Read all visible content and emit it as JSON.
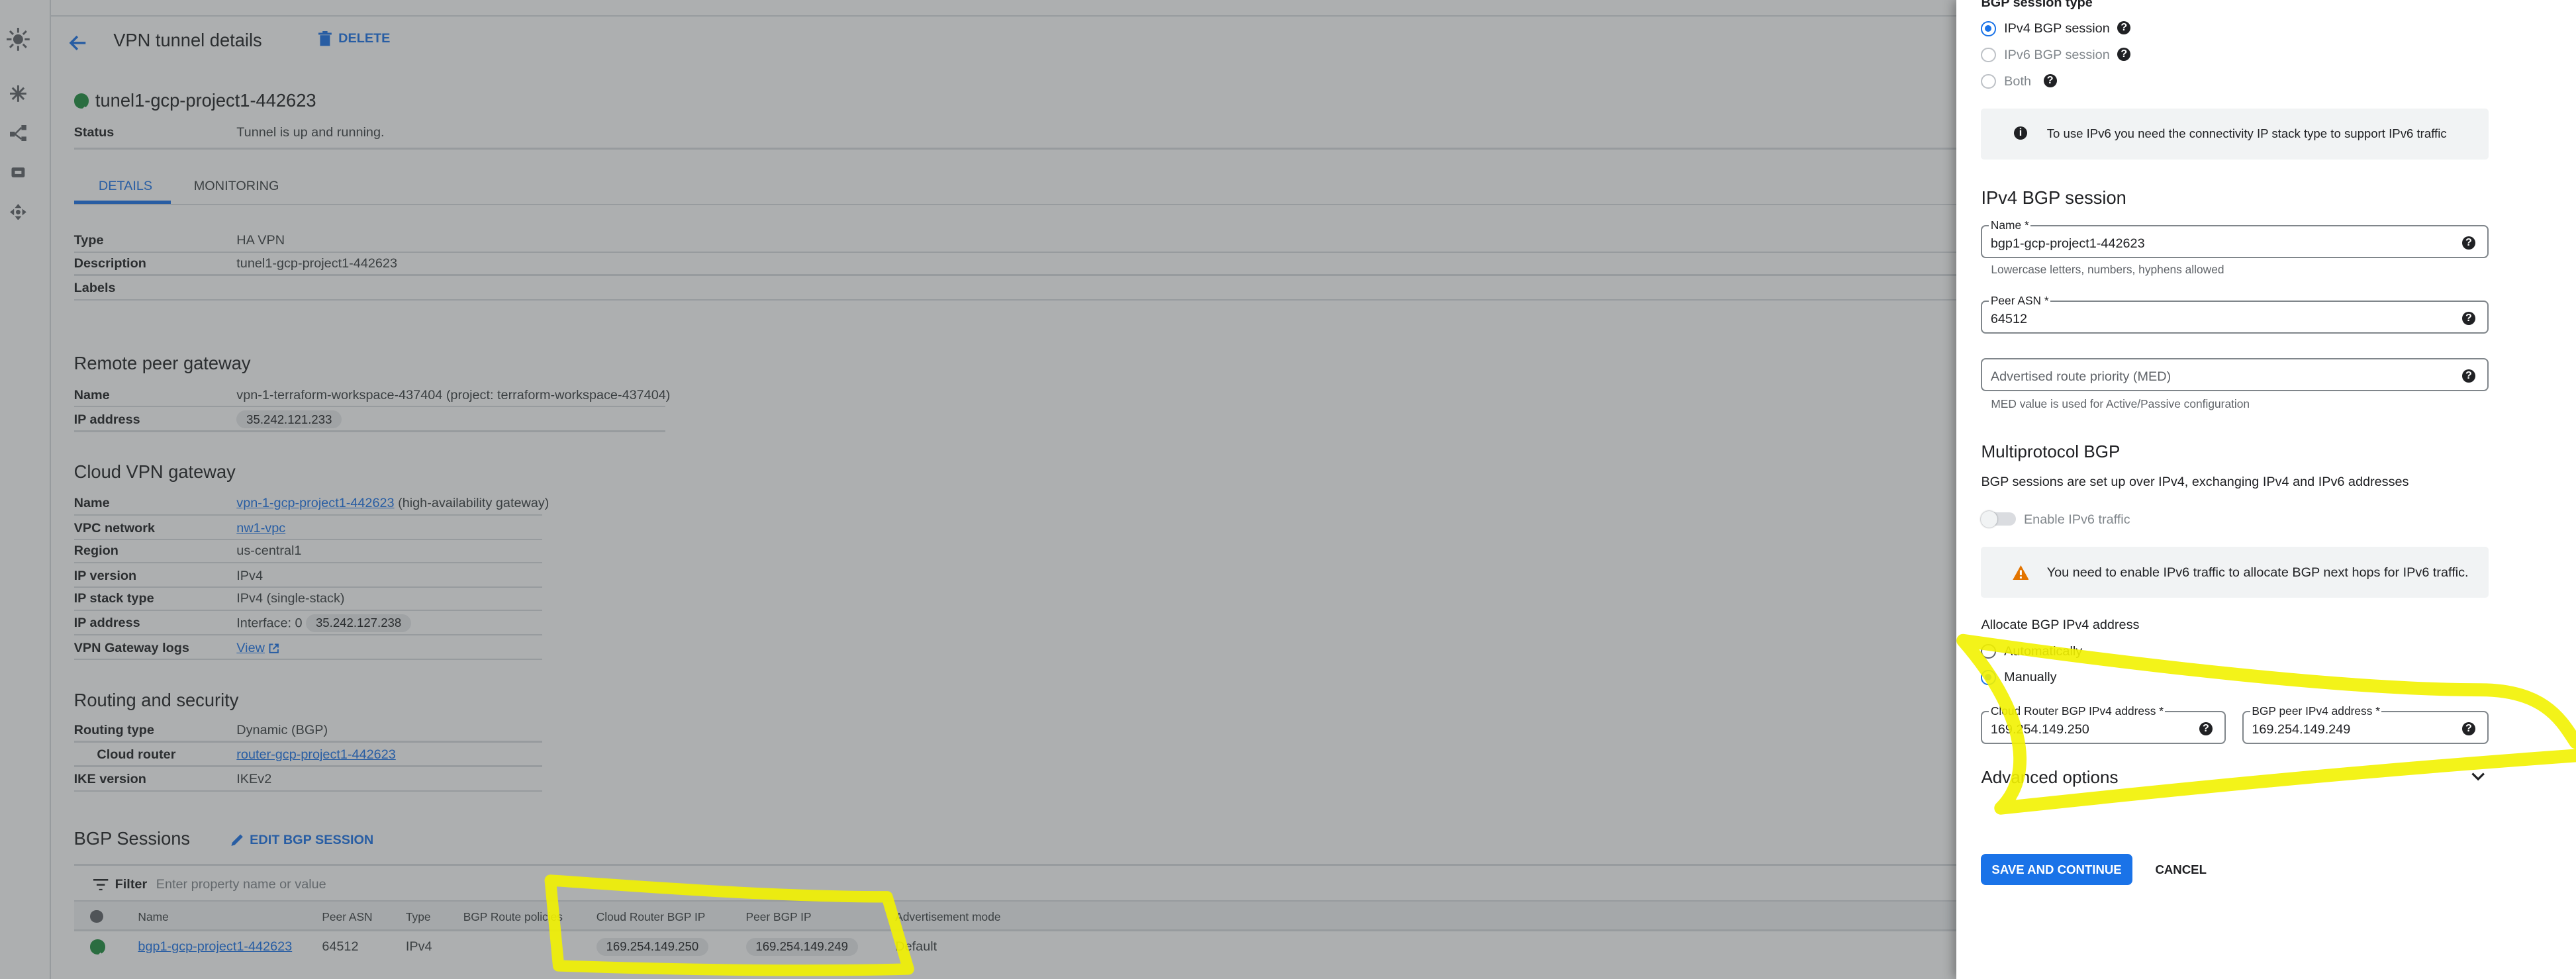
{
  "header": {
    "title": "VPN tunnel details",
    "delete_label": "DELETE"
  },
  "tunnel": {
    "name": "tunel1-gcp-project1-442623",
    "status_label": "Status",
    "status_value": "Tunnel is up and running."
  },
  "tabs": [
    {
      "label": "DETAILS"
    },
    {
      "label": "MONITORING"
    }
  ],
  "details": [
    {
      "label": "Type",
      "value": "HA VPN"
    },
    {
      "label": "Description",
      "value": "tunel1-gcp-project1-442623"
    },
    {
      "label": "Labels",
      "value": ""
    }
  ],
  "remote_peer": {
    "title": "Remote peer gateway",
    "name_label": "Name",
    "name_value": "vpn-1-terraform-workspace-437404 (project: terraform-workspace-437404)",
    "ip_label": "IP address",
    "ip_value": "35.242.121.233"
  },
  "cloud_vpn": {
    "title": "Cloud VPN gateway",
    "name_label": "Name",
    "name_link": "vpn-1-gcp-project1-442623",
    "name_suffix": "(high-availability gateway)",
    "vpc_label": "VPC network",
    "vpc_link": "nw1-vpc",
    "region_label": "Region",
    "region_value": "us-central1",
    "ipver_label": "IP version",
    "ipver_value": "IPv4",
    "stack_label": "IP stack type",
    "stack_value": "IPv4 (single-stack)",
    "ip_label": "IP address",
    "ip_iface": "Interface: 0",
    "ip_value": "35.242.127.238",
    "logs_label": "VPN Gateway logs",
    "logs_link": "View"
  },
  "routing": {
    "title": "Routing and security",
    "type_label": "Routing type",
    "type_value": "Dynamic (BGP)",
    "router_label": "Cloud router",
    "router_link": "router-gcp-project1-442623",
    "ike_label": "IKE version",
    "ike_value": "IKEv2"
  },
  "bgp_sessions": {
    "title": "BGP Sessions",
    "edit_label": "EDIT BGP SESSION",
    "filter_label": "Filter",
    "filter_placeholder": "Enter property name or value",
    "columns": [
      "Name",
      "Peer ASN",
      "Type",
      "BGP Route policies",
      "Cloud Router BGP IP",
      "Peer BGP IP",
      "Advertisement mode"
    ],
    "row": {
      "name": "bgp1-gcp-project1-442623",
      "asn": "64512",
      "type": "IPv4",
      "policies": "",
      "cr_ip": "169.254.149.250",
      "peer_ip": "169.254.149.249",
      "mode": "Default"
    }
  },
  "panel": {
    "session_type_label": "BGP session type",
    "options": [
      "IPv4 BGP session",
      "IPv6 BGP session",
      "Both"
    ],
    "ipv6_info": "To use IPv6 you need the connectivity IP stack type to support IPv6 traffic",
    "ipv4_title": "IPv4 BGP session",
    "name_label": "Name *",
    "name_value": "bgp1-gcp-project1-442623",
    "name_hint": "Lowercase letters, numbers, hyphens allowed",
    "asn_label": "Peer ASN *",
    "asn_value": "64512",
    "med_placeholder": "Advertised route priority (MED)",
    "med_hint": "MED value is used for Active/Passive configuration",
    "mp_title": "Multiprotocol BGP",
    "mp_desc": "BGP sessions are set up over IPv4, exchanging IPv4 and IPv6 addresses",
    "enable_ipv6": "Enable IPv6 traffic",
    "warn_text": "You need to enable IPv6 traffic to allocate BGP next hops for IPv6 traffic.",
    "alloc_title": "Allocate BGP IPv4 address",
    "alloc_options": [
      "Automatically",
      "Manually"
    ],
    "cr_label": "Cloud Router BGP IPv4 address *",
    "cr_value": "169.254.149.250",
    "peer_label": "BGP peer IPv4 address *",
    "peer_value": "169.254.149.249",
    "advanced": "Advanced options",
    "save": "SAVE AND CONTINUE",
    "cancel": "CANCEL"
  },
  "colors": {
    "accent": "#1a73e8",
    "highlight": "#f2f200",
    "success": "#1e8e3e",
    "warning": "#e37400"
  }
}
